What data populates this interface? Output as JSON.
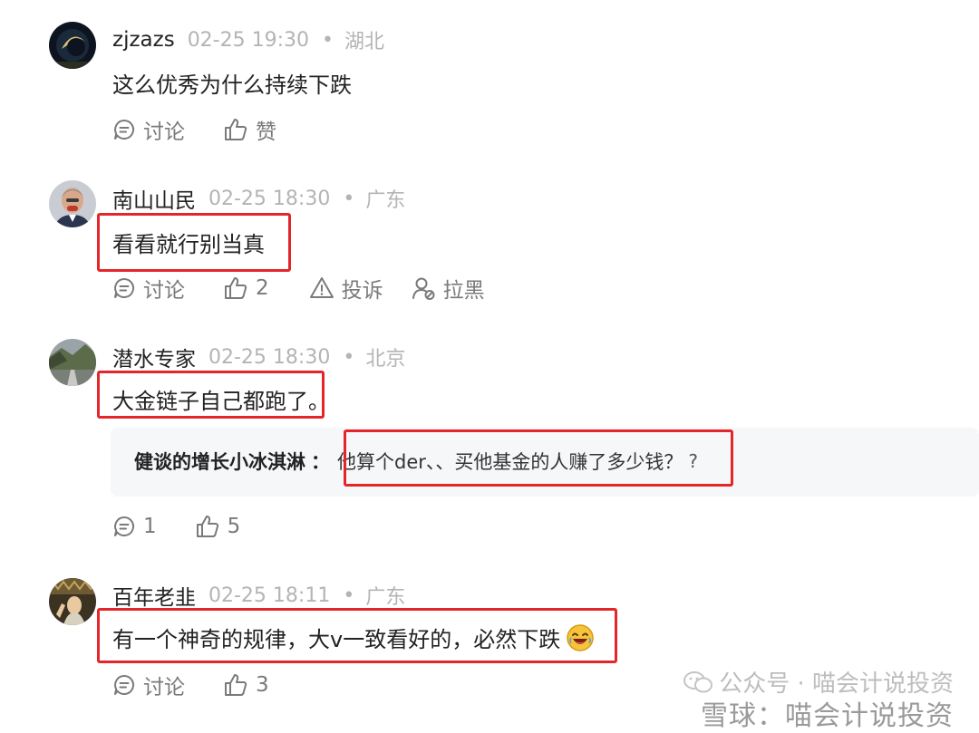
{
  "comments": [
    {
      "username": "zjzazs",
      "time": "02-25 19:30",
      "separator": "•",
      "location": "湖北",
      "content": "这么优秀为什么持续下跌",
      "actions": {
        "discuss": "讨论",
        "like": "赞"
      }
    },
    {
      "username": "南山山民",
      "time": "02-25 18:30",
      "separator": "•",
      "location": "广东",
      "content": "看看就行别当真",
      "actions": {
        "discuss": "讨论",
        "like": "2",
        "report": "投诉",
        "block": "拉黑"
      }
    },
    {
      "username": "潜水专家",
      "time": "02-25 18:30",
      "separator": "•",
      "location": "北京",
      "content": "大金链子自己都跑了。",
      "reply": {
        "user": "健谈的增长小冰淇淋",
        "colon": "：",
        "text": "他算个der、、买他基金的人赚了多少钱？",
        "extra": "?"
      },
      "actions": {
        "discuss": "1",
        "like": "5"
      }
    },
    {
      "username": "百年老韭",
      "time": "02-25 18:11",
      "separator": "•",
      "location": "广东",
      "content": "有一个神奇的规律，大v一致看好的，必然下跌",
      "emoji": "laughing-emoji",
      "actions": {
        "discuss": "讨论",
        "like": "3"
      }
    }
  ],
  "watermark": {
    "line1": "公众号 · 喵会计说投资",
    "line2": "雪球：喵会计说投资"
  },
  "colors": {
    "highlight": "#e4262b",
    "meta": "#b4b4b4",
    "action": "#7a7a7a",
    "reply_bg": "#f6f7f9"
  }
}
